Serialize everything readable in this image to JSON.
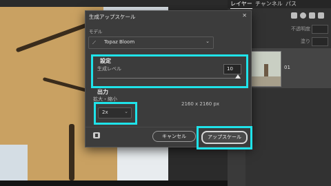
{
  "dialog": {
    "title": "生成アップスケール",
    "close_glyph": "✕",
    "model_label": "モデル",
    "model_value": "Topaz Bloom",
    "settings_title": "設定",
    "generation_level_label": "生成レベル",
    "generation_level_value": "10",
    "output_title": "出力",
    "scale_label": "拡大・縮小",
    "scale_value": "2x",
    "output_size": "2160 x 2160 px",
    "cancel_label": "キャンセル",
    "upscale_label": "アップスケール"
  },
  "layers_panel": {
    "tabs": [
      "レイヤー",
      "チャンネル",
      "パス"
    ],
    "opacity_label": "不透明度",
    "fill_label": "塗り",
    "layer_name": "01"
  },
  "icons": {
    "model_icon": "brush-sparkle-icon",
    "chevron": "chevron-down-icon",
    "help": "feedback-icon"
  },
  "colors": {
    "highlight": "#1fe3ea",
    "dialog_bg": "#3c3c3c"
  }
}
